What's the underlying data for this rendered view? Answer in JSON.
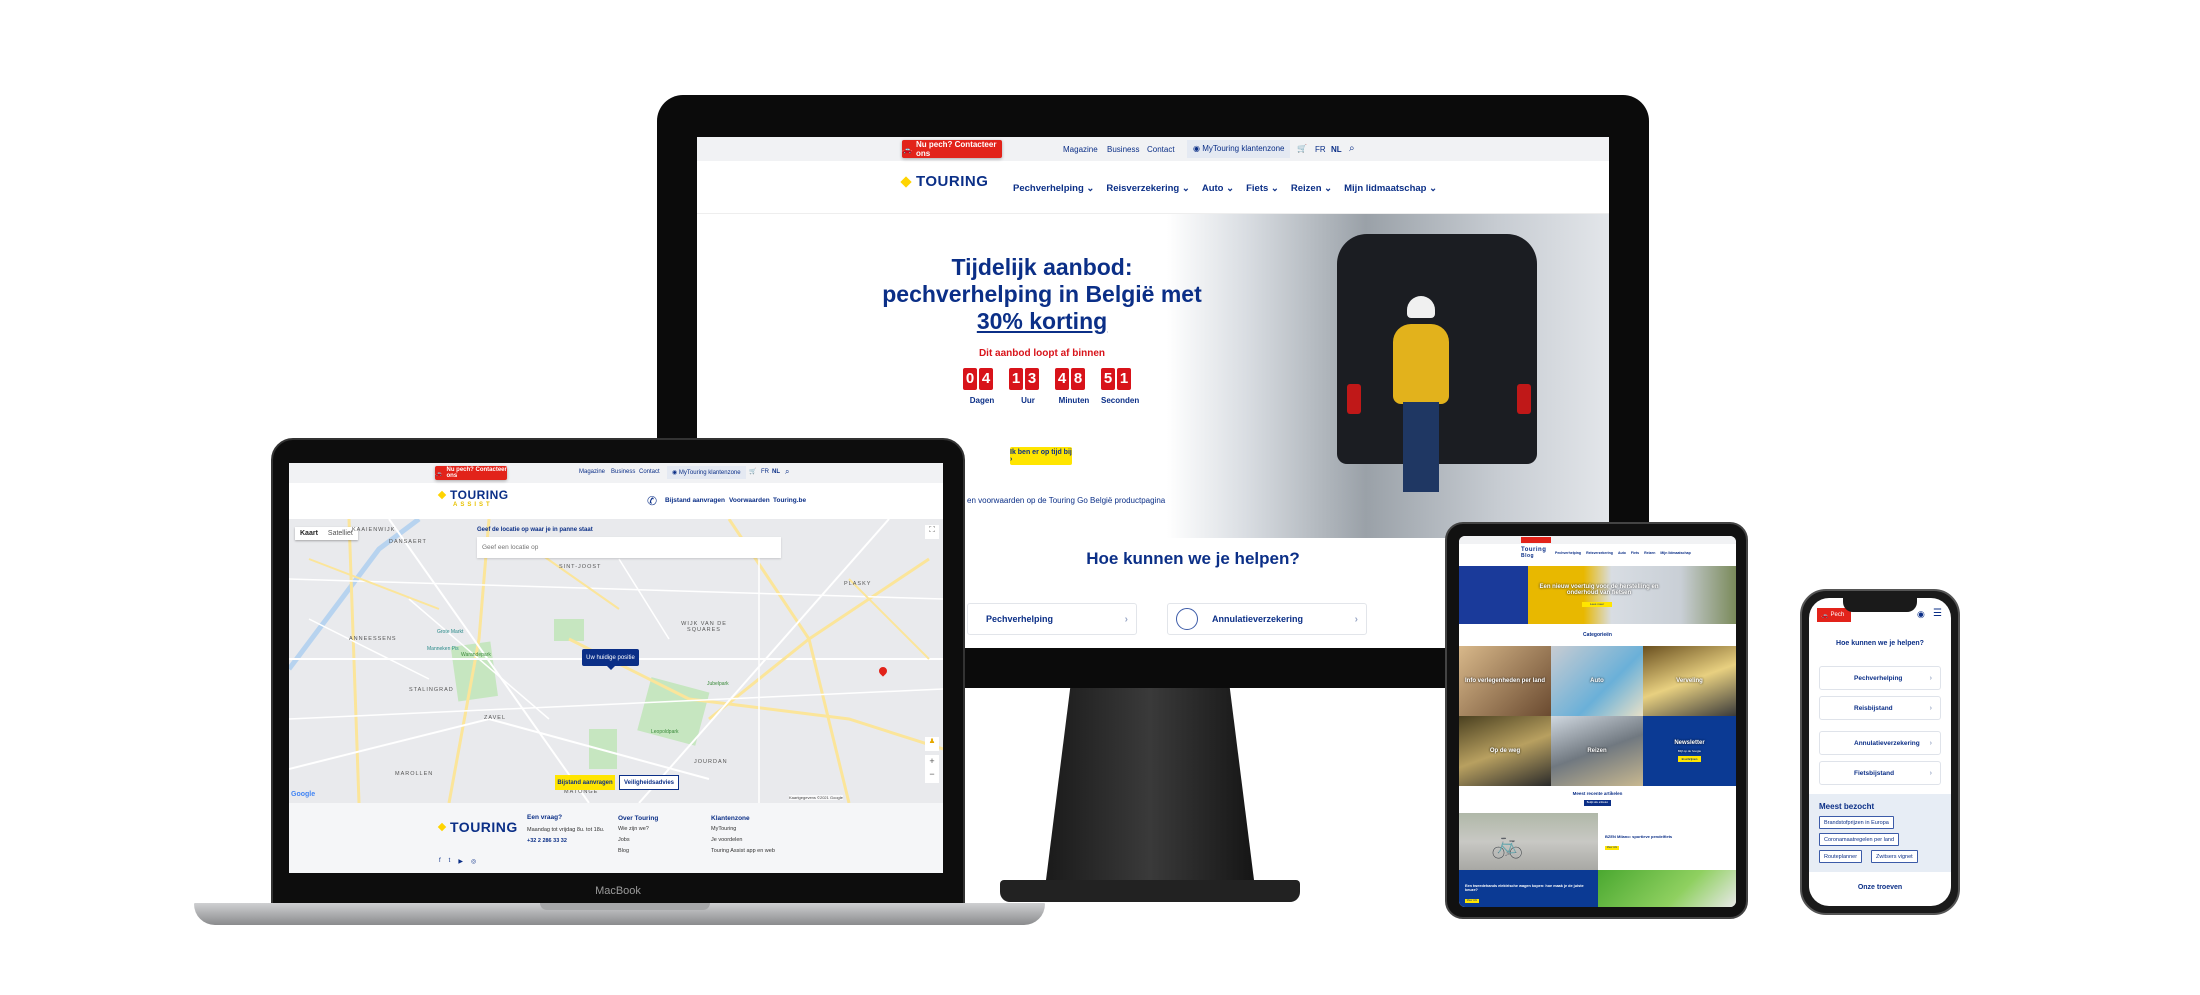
{
  "colors": {
    "brand_navy": "#0b2f87",
    "brand_red": "#e2231a",
    "brand_yellow": "#ffe500"
  },
  "imac": {
    "topbar": {
      "emergency_button": "Nu pech? Contacteer ons",
      "links": [
        "Magazine",
        "Business",
        "Contact"
      ],
      "account": "MyTouring klantenzone",
      "lang": [
        "FR",
        "NL"
      ],
      "icons": [
        "car-icon",
        "user-icon",
        "cart-icon",
        "search-icon"
      ]
    },
    "logo": "TOURING",
    "menu": [
      "Pechverhelping",
      "Reisverzekering",
      "Auto",
      "Fiets",
      "Reizen",
      "Mijn lidmaatschap"
    ],
    "hero": {
      "title_line1": "Tijdelijk aanbod:",
      "title_line2": "pechverhelping in België met",
      "title_highlight": "30% korting",
      "countdown_label": "Dit aanbod loopt af binnen",
      "countdown": [
        {
          "digits": "04",
          "unit": "Dagen"
        },
        {
          "digits": "13",
          "unit": "Uur"
        },
        {
          "digits": "48",
          "unit": "Minuten"
        },
        {
          "digits": "51",
          "unit": "Seconden"
        }
      ],
      "cta": "Ik ben er op tijd bij ›",
      "footnote": "en voorwaarden op de Touring Go België productpagina"
    },
    "help": {
      "title": "Hoe kunnen we je helpen?",
      "cards": [
        "Pechverhelping",
        "Annulatieverzekering"
      ]
    }
  },
  "macbook": {
    "label": "MacBook",
    "topbar": {
      "emergency_button": "Nu pech? Contacteer ons",
      "links": [
        "Magazine",
        "Business",
        "Contact"
      ],
      "account": "MyTouring klantenzone",
      "lang": [
        "FR",
        "NL"
      ]
    },
    "logo": "TOURING",
    "logo_sub": "ASSIST",
    "nav": [
      "Bijstand aanvragen",
      "Voorwaarden",
      "Touring.be"
    ],
    "map": {
      "type_buttons": [
        "Kaart",
        "Satelliet"
      ],
      "search_label": "Geef de locatie op waar je in panne staat",
      "search_placeholder": "Geef een locatie op",
      "position_tooltip": "Uw huidige positie",
      "places": [
        "KAAIENWIJK",
        "DANSAERT",
        "SINT-JOOST",
        "PLASKY",
        "WIJK VAN DE SQUARES",
        "ANNEESSENS",
        "STALINGRAD",
        "ZAVEL",
        "MAROLLEN",
        "JOURDAN",
        "MATONGE",
        "Grote Markt",
        "Manneken Pis",
        "Warandepark",
        "Leopoldpark",
        "Jubelpark"
      ],
      "buttons": [
        "Bijstand aanvragen",
        "Veiligheidsadvies"
      ],
      "attribution": "Kaartgegevens ©2021 Google",
      "brand": "Google"
    },
    "footer": {
      "logo": "TOURING",
      "columns": [
        {
          "title": "Een vraag?",
          "items": [
            "Maandag tot vrijdag 8u. tot 18u.",
            "+32 2 286 33 32"
          ]
        },
        {
          "title": "Over Touring",
          "items": [
            "Wie zijn we?",
            "Jobs",
            "Blog"
          ]
        },
        {
          "title": "Klantenzone",
          "items": [
            "MyTouring",
            "Je voordelen",
            "Touring Assist app en web"
          ]
        }
      ]
    }
  },
  "ipad": {
    "logo": "Touring",
    "logo_sub": "Blog",
    "menu": [
      "Pechverhelping",
      "Reisverzekering",
      "Auto",
      "Fiets",
      "Reizen",
      "Mijn lidmaatschap"
    ],
    "hero": {
      "title": "Een nieuw voertuig voor de herstelling en onderhoud van fietsen",
      "cta": "Lees meer"
    },
    "categories_title": "Categorieën",
    "tiles": [
      "Info verlegenheden per land",
      "Auto",
      "Verveling",
      "Op de weg",
      "Reizen"
    ],
    "newsletter": {
      "title": "Newsletter",
      "text": "Blijf op de hoogte",
      "button": "Inschrijven"
    },
    "recent_title": "Meest recente artikelen",
    "recent_button": "Bekijk alle artikelen",
    "articles": [
      {
        "title": "BZEN Milano: sportieve pendelfiets",
        "button": "Meer info"
      },
      {
        "title": "Een tweedehands elektrische wagen kopen: hoe maak je de juiste keuze?",
        "button": "Meer info"
      }
    ]
  },
  "iphone": {
    "emergency_button": "Pech",
    "help_title": "Hoe kunnen we je helpen?",
    "cards": [
      "Pechverhelping",
      "Reisbijstand",
      "Annulatieverzekering",
      "Fietsbijstand"
    ],
    "most_visited": {
      "title": "Meest bezocht",
      "chips": [
        "Brandstofprijzen in Europa",
        "Coronamaatregelen per land",
        "Routeplanner",
        "Zwitsers vignet"
      ]
    },
    "section": "Onze troeven"
  }
}
